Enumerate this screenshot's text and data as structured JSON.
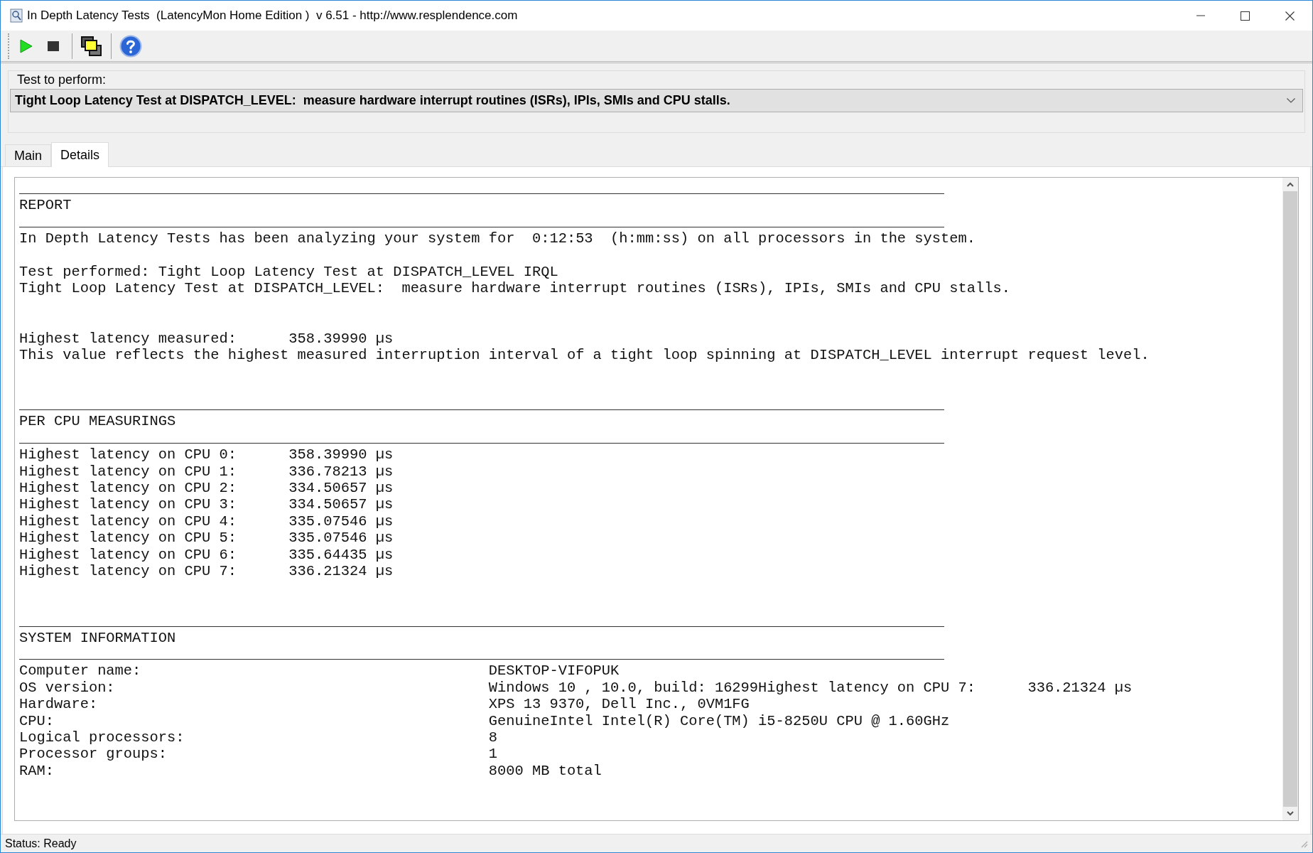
{
  "window": {
    "title": "In Depth Latency Tests  (LatencyMon Home Edition )  v 6.51 - http://www.resplendence.com"
  },
  "toolbar": [
    {
      "kind": "play"
    },
    {
      "kind": "stop"
    },
    {
      "kind": "separator"
    },
    {
      "kind": "windows"
    },
    {
      "kind": "separator"
    },
    {
      "kind": "help"
    }
  ],
  "test_selector": {
    "label": "Test to perform:",
    "value": "Tight Loop Latency Test at DISPATCH_LEVEL:  measure hardware interrupt routines (ISRs), IPIs, SMIs and CPU stalls."
  },
  "tabs": [
    {
      "label": "Main",
      "selected": false
    },
    {
      "label": "Details",
      "selected": true
    }
  ],
  "report": {
    "lines": [
      {
        "kind": "rule"
      },
      {
        "kind": "text",
        "text": "REPORT"
      },
      {
        "kind": "rule"
      },
      {
        "kind": "text",
        "text": "In Depth Latency Tests has been analyzing your system for  0:12:53  (h:mm:ss) on all processors in the system."
      },
      {
        "kind": "blank"
      },
      {
        "kind": "text",
        "text": "Test performed: Tight Loop Latency Test at DISPATCH_LEVEL IRQL"
      },
      {
        "kind": "text",
        "text": "Tight Loop Latency Test at DISPATCH_LEVEL:  measure hardware interrupt routines (ISRs), IPIs, SMIs and CPU stalls."
      },
      {
        "kind": "blank"
      },
      {
        "kind": "blank"
      },
      {
        "kind": "text",
        "text": "Highest latency measured:      358.39990 µs"
      },
      {
        "kind": "text",
        "text": "This value reflects the highest measured interruption interval of a tight loop spinning at DISPATCH_LEVEL interrupt request level."
      },
      {
        "kind": "blank"
      },
      {
        "kind": "blank"
      },
      {
        "kind": "rule"
      },
      {
        "kind": "text",
        "text": "PER CPU MEASURINGS"
      },
      {
        "kind": "rule"
      },
      {
        "kind": "text",
        "text": "Highest latency on CPU 0:      358.39990 µs"
      },
      {
        "kind": "text",
        "text": "Highest latency on CPU 1:      336.78213 µs"
      },
      {
        "kind": "text",
        "text": "Highest latency on CPU 2:      334.50657 µs"
      },
      {
        "kind": "text",
        "text": "Highest latency on CPU 3:      334.50657 µs"
      },
      {
        "kind": "text",
        "text": "Highest latency on CPU 4:      335.07546 µs"
      },
      {
        "kind": "text",
        "text": "Highest latency on CPU 5:      335.07546 µs"
      },
      {
        "kind": "text",
        "text": "Highest latency on CPU 6:      335.64435 µs"
      },
      {
        "kind": "text",
        "text": "Highest latency on CPU 7:      336.21324 µs"
      },
      {
        "kind": "blank"
      },
      {
        "kind": "blank"
      },
      {
        "kind": "rule"
      },
      {
        "kind": "text",
        "text": "SYSTEM INFORMATION"
      },
      {
        "kind": "rule"
      },
      {
        "kind": "field",
        "label": "Computer name:",
        "value": "DESKTOP-VIFOPUK"
      },
      {
        "kind": "field",
        "label": "OS version:",
        "value": "Windows 10 , 10.0, build: 16299Highest latency on CPU 7:      336.21324 µs"
      },
      {
        "kind": "field",
        "label": "Hardware:",
        "value": "XPS 13 9370, Dell Inc., 0VM1FG"
      },
      {
        "kind": "field",
        "label": "CPU:",
        "value": "GenuineIntel Intel(R) Core(TM) i5-8250U CPU @ 1.60GHz"
      },
      {
        "kind": "field",
        "label": "Logical processors:",
        "value": "8"
      },
      {
        "kind": "field",
        "label": "Processor groups:",
        "value": "1"
      },
      {
        "kind": "field",
        "label": "RAM:",
        "value": "8000 MB total"
      }
    ]
  },
  "status_bar": {
    "text": "Status: Ready"
  }
}
